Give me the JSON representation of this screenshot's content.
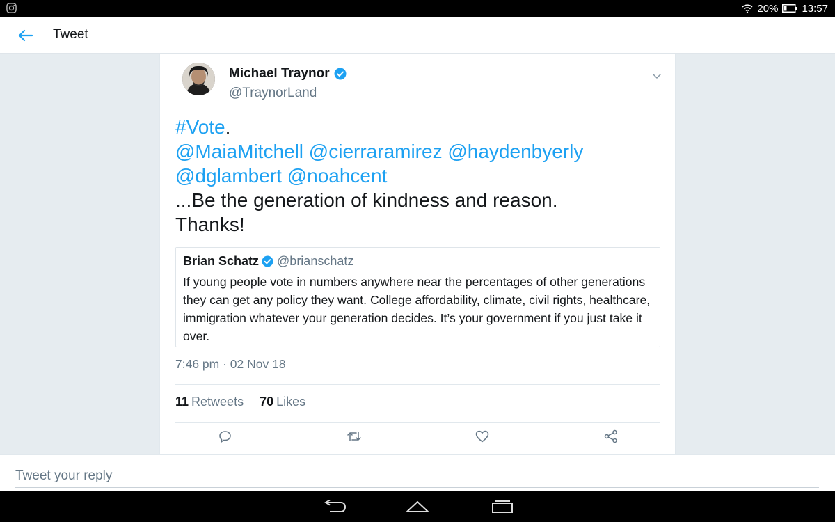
{
  "status_bar": {
    "left_icon": "instagram-icon",
    "battery": "20%",
    "time": "13:57",
    "icons": [
      "wifi-icon",
      "battery-icon"
    ]
  },
  "app_bar": {
    "title": "Tweet",
    "back_icon": "arrow-left-icon"
  },
  "tweet": {
    "author_name": "Michael Traynor",
    "author_handle": "@TraynorLand",
    "verified": true,
    "text": {
      "hashtag": "#Vote",
      "hashtag_suffix": ".",
      "mentions_line1": "@MaiaMitchell @cierraramirez @haydenbyerly",
      "mentions_line2": "@dglambert @noahcent",
      "line3": "...Be the generation of kindness and reason.",
      "line4": "Thanks!"
    },
    "quote": {
      "author_name": "Brian Schatz",
      "author_handle": "@brianschatz",
      "verified": true,
      "text": "If young people vote in numbers anywhere near the percentages of other generations they can get any policy they want. College affordability, climate, civil rights, healthcare, immigration whatever your generation decides. It’s your government if you just take it over."
    },
    "timestamp": "7:46 pm · 02 Nov 18",
    "retweets_count": "11",
    "retweets_label": "Retweets",
    "likes_count": "70",
    "likes_label": "Likes",
    "actions": [
      "reply-icon",
      "retweet-icon",
      "like-icon",
      "share-icon"
    ]
  },
  "reply": {
    "placeholder": "Tweet your reply"
  },
  "colors": {
    "accent": "#1da1f2",
    "secondary_text": "#657786",
    "background": "#e6ecf0"
  },
  "nav_bar": {
    "buttons": [
      "back-nav-icon",
      "home-nav-icon",
      "recents-nav-icon"
    ]
  }
}
